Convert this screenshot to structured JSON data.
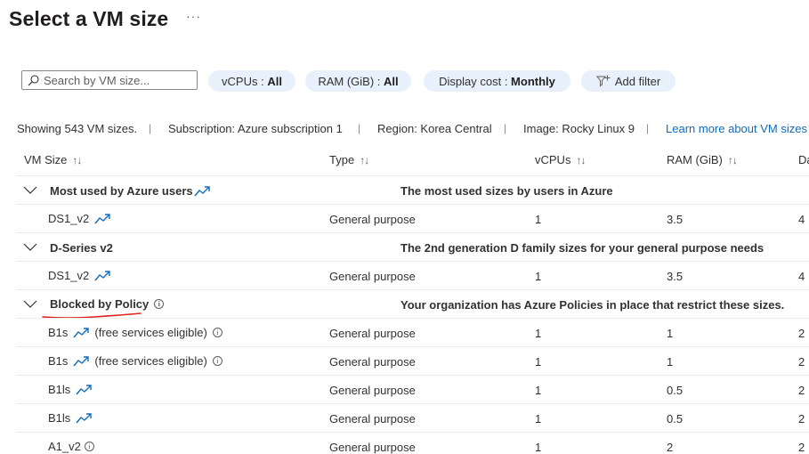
{
  "page": {
    "title": "Select a VM size",
    "more": "···"
  },
  "search": {
    "placeholder": "Search by VM size..."
  },
  "filters": [
    {
      "label": "vCPUs : ",
      "value": "All"
    },
    {
      "label": "RAM (GiB) : ",
      "value": "All"
    },
    {
      "label": "Display cost : ",
      "value": "Monthly"
    },
    {
      "label": "Add filter",
      "value": ""
    }
  ],
  "info": {
    "showing": "Showing 543 VM sizes.",
    "subscription": "Subscription: Azure subscription 1",
    "region": "Region: Korea Central",
    "image": "Image: Rocky Linux 9",
    "learn_more": "Learn more about VM sizes",
    "separator": "|"
  },
  "columns": [
    {
      "label": "VM Size",
      "sort": "↑↓"
    },
    {
      "label": "Type",
      "sort": "↑↓"
    },
    {
      "label": "vCPUs",
      "sort": "↑↓"
    },
    {
      "label": "RAM (GiB)",
      "sort": "↑↓"
    },
    {
      "label": "Da",
      "sort": ""
    }
  ],
  "groups": [
    {
      "name": "Most used by Azure users",
      "description": "The most used sizes by users in Azure",
      "rows": [
        {
          "size": "DS1_v2",
          "note": "",
          "type": "General purpose",
          "vcpus": "1",
          "ram": "3.5",
          "d": "4"
        }
      ]
    },
    {
      "name": "D-Series v2",
      "description": "The 2nd generation D family sizes for your general purpose needs",
      "rows": [
        {
          "size": "DS1_v2",
          "note": "",
          "type": "General purpose",
          "vcpus": "1",
          "ram": "3.5",
          "d": "4"
        }
      ]
    },
    {
      "name": "Blocked by Policy",
      "description": "Your organization has Azure Policies in place that restrict these sizes.",
      "info_glyph": "i",
      "rows": [
        {
          "size": "B1s",
          "note": "(free services eligible)",
          "type": "General purpose",
          "vcpus": "1",
          "ram": "1",
          "d": "2"
        },
        {
          "size": "B1s",
          "note": "(free services eligible)",
          "type": "General purpose",
          "vcpus": "1",
          "ram": "1",
          "d": "2"
        },
        {
          "size": "B1ls",
          "note": "",
          "type": "General purpose",
          "vcpus": "1",
          "ram": "0.5",
          "d": "2"
        },
        {
          "size": "B1ls",
          "note": "",
          "type": "General purpose",
          "vcpus": "1",
          "ram": "0.5",
          "d": "2"
        },
        {
          "size": "A1_v2",
          "note": "",
          "type": "General purpose",
          "vcpus": "1",
          "ram": "2",
          "d": "2"
        }
      ]
    }
  ],
  "colors": {
    "accent": "#0f6cbd",
    "pill_bg": "#e8f1fb",
    "annotation_underline": "#e02020"
  }
}
